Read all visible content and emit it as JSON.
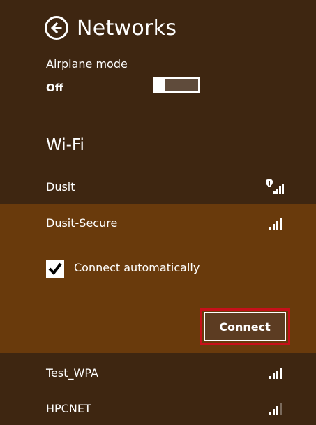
{
  "header": {
    "title": "Networks"
  },
  "airplane": {
    "label": "Airplane mode",
    "state": "Off"
  },
  "wifi": {
    "section_label": "Wi-Fi",
    "networks": [
      {
        "name": "Dusit",
        "icon": "signal-warning-icon"
      },
      {
        "name": "Dusit-Secure",
        "icon": "signal-icon",
        "selected": true
      },
      {
        "name": "Test_WPA",
        "icon": "signal-icon"
      },
      {
        "name": "HPCNET",
        "icon": "signal-icon"
      }
    ],
    "connect_auto_label": "Connect automatically",
    "connect_auto_checked": true,
    "connect_label": "Connect"
  },
  "colors": {
    "background": "#3e2611",
    "selected_background": "#693a0c",
    "highlight_border": "#c8101a"
  }
}
